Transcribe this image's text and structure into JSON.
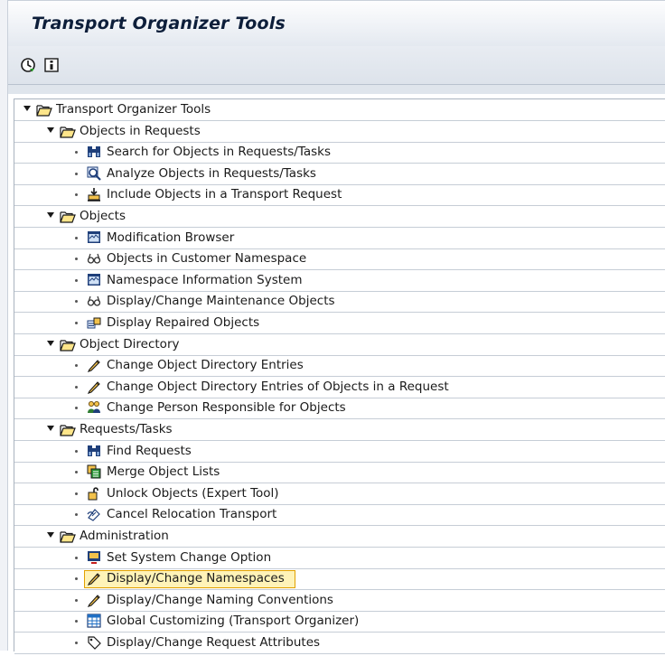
{
  "window": {
    "title": "Transport Organizer Tools"
  },
  "toolbar": {
    "buttons": [
      {
        "icon": "execute-clock-icon"
      },
      {
        "icon": "info-icon"
      }
    ]
  },
  "tree": {
    "root": "Transport Organizer Tools",
    "groups": [
      {
        "label": "Objects in Requests",
        "items": [
          {
            "label": "Search for Objects in Requests/Tasks",
            "icon": "binoculars-icon"
          },
          {
            "label": "Analyze Objects in Requests/Tasks",
            "icon": "analyze-icon"
          },
          {
            "label": "Include Objects in a Transport Request",
            "icon": "include-icon"
          }
        ]
      },
      {
        "label": "Objects",
        "items": [
          {
            "label": "Modification Browser",
            "icon": "screen-icon"
          },
          {
            "label": "Objects in Customer Namespace",
            "icon": "glasses-icon"
          },
          {
            "label": "Namespace Information System",
            "icon": "screen-icon"
          },
          {
            "label": "Display/Change Maintenance Objects",
            "icon": "glasses-icon"
          },
          {
            "label": "Display Repaired Objects",
            "icon": "repair-icon"
          }
        ]
      },
      {
        "label": "Object Directory",
        "items": [
          {
            "label": "Change Object Directory Entries",
            "icon": "pencil-icon"
          },
          {
            "label": "Change Object Directory Entries of Objects in a Request",
            "icon": "pencil-icon"
          },
          {
            "label": "Change Person Responsible for Objects",
            "icon": "persons-icon"
          }
        ]
      },
      {
        "label": "Requests/Tasks",
        "items": [
          {
            "label": "Find Requests",
            "icon": "binoculars-icon"
          },
          {
            "label": "Merge Object Lists",
            "icon": "merge-icon"
          },
          {
            "label": "Unlock Objects (Expert Tool)",
            "icon": "unlock-icon"
          },
          {
            "label": "Cancel Relocation Transport",
            "icon": "cancel-relocation-icon"
          }
        ]
      },
      {
        "label": "Administration",
        "items": [
          {
            "label": "Set System Change Option",
            "icon": "flag-screen-icon"
          },
          {
            "label": "Display/Change Namespaces",
            "icon": "pencil-icon",
            "selected": true
          },
          {
            "label": "Display/Change Naming Conventions",
            "icon": "pencil-icon"
          },
          {
            "label": "Global Customizing (Transport Organizer)",
            "icon": "table-icon"
          },
          {
            "label": "Display/Change Request Attributes",
            "icon": "tag-icon"
          }
        ]
      }
    ]
  },
  "colors": {
    "selection_fill": "#fff3b8",
    "selection_border": "#e2a100",
    "title_text": "#0d1e3a"
  }
}
